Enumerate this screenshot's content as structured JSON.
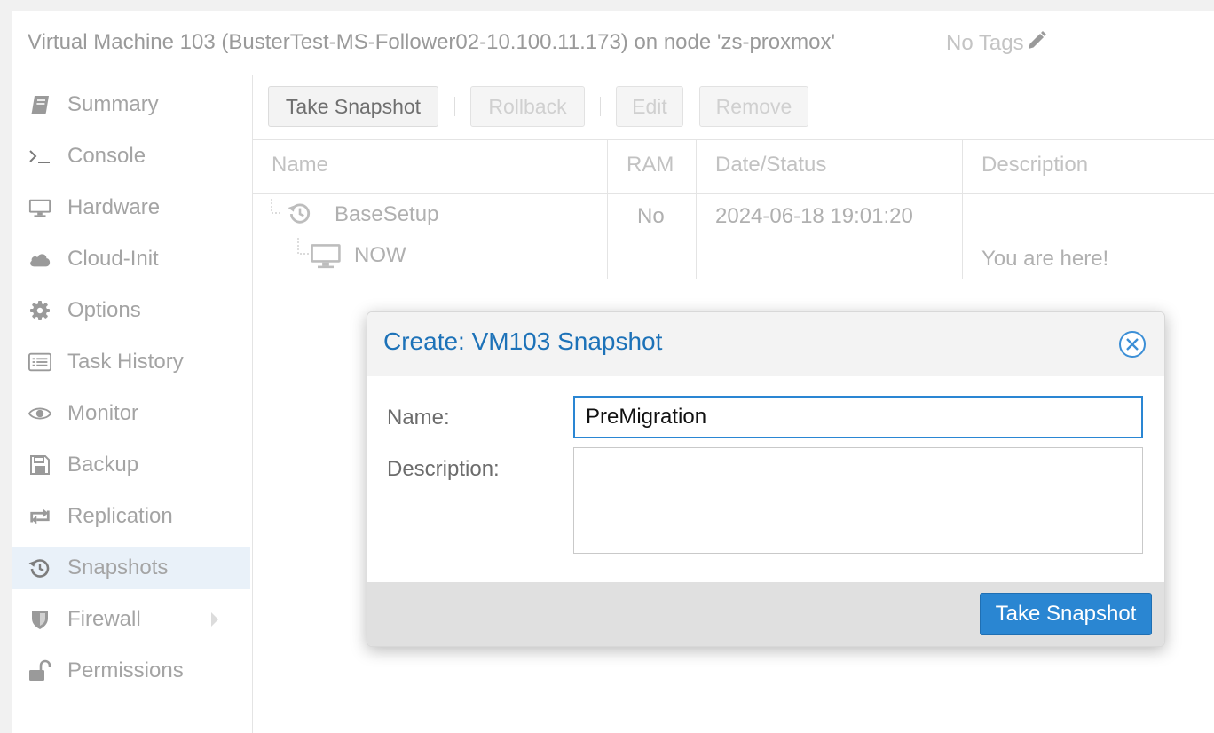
{
  "header": {
    "title": "Virtual Machine 103 (BusterTest-MS-Follower02-10.100.11.173) on node 'zs-proxmox'",
    "tags": "No Tags"
  },
  "sidebar": {
    "items": [
      {
        "label": "Summary",
        "icon": "book-icon"
      },
      {
        "label": "Console",
        "icon": "terminal-icon"
      },
      {
        "label": "Hardware",
        "icon": "monitor-icon"
      },
      {
        "label": "Cloud-Init",
        "icon": "cloud-icon"
      },
      {
        "label": "Options",
        "icon": "gear-icon"
      },
      {
        "label": "Task History",
        "icon": "list-icon"
      },
      {
        "label": "Monitor",
        "icon": "eye-icon"
      },
      {
        "label": "Backup",
        "icon": "floppy-icon"
      },
      {
        "label": "Replication",
        "icon": "retweet-icon"
      },
      {
        "label": "Snapshots",
        "icon": "history-icon",
        "selected": true
      },
      {
        "label": "Firewall",
        "icon": "shield-icon",
        "has_submenu": true
      },
      {
        "label": "Permissions",
        "icon": "unlock-icon"
      }
    ]
  },
  "toolbar": {
    "take_snapshot": "Take Snapshot",
    "rollback": "Rollback",
    "edit": "Edit",
    "remove": "Remove"
  },
  "grid": {
    "columns": [
      "Name",
      "RAM",
      "Date/Status",
      "Description"
    ],
    "rows": [
      {
        "name": "BaseSetup",
        "ram": "No",
        "date": "2024-06-18 19:01:20",
        "description": ""
      },
      {
        "name": "NOW",
        "ram": "",
        "date": "",
        "description": "You are here!"
      }
    ]
  },
  "dialog": {
    "title": "Create: VM103 Snapshot",
    "name_label": "Name:",
    "name_value": "PreMigration",
    "description_label": "Description:",
    "description_value": "",
    "submit": "Take Snapshot"
  },
  "colors": {
    "accent": "#2a86d2",
    "title_blue": "#1d72b8",
    "selected_bg": "#e9f1f9"
  }
}
